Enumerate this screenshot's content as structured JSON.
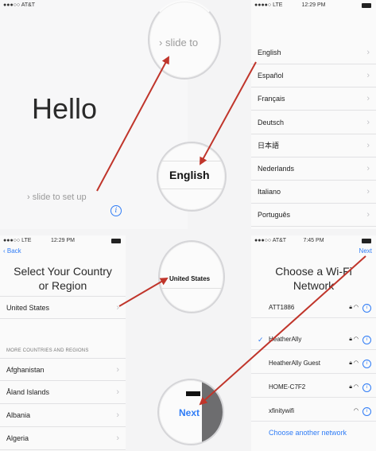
{
  "hello_screen": {
    "status": {
      "carrier": "AT&T",
      "signal": "●●●○○"
    },
    "title": "Hello",
    "slide_hint": "› slide to set up"
  },
  "magnifier_slide": {
    "text": "› slide to"
  },
  "magnifier_english": {
    "text": "English"
  },
  "magnifier_country": {
    "text": "United States"
  },
  "magnifier_next": {
    "text": "Next"
  },
  "language_screen": {
    "status": {
      "signal": "●●●●○",
      "network": "LTE",
      "time": "12:29 PM"
    },
    "languages": [
      {
        "label": "English"
      },
      {
        "label": "Español"
      },
      {
        "label": "Français"
      },
      {
        "label": "Deutsch"
      },
      {
        "label": "日本語"
      },
      {
        "label": "Nederlands"
      },
      {
        "label": "Italiano"
      },
      {
        "label": "Português"
      }
    ]
  },
  "country_screen": {
    "status": {
      "signal": "●●●○○",
      "network": "LTE",
      "time": "12:29 PM"
    },
    "back_label": "‹ Back",
    "heading_line1": "Select Your Country",
    "heading_line2": "or Region",
    "selected_country": "United States",
    "section_header": "MORE COUNTRIES AND REGIONS",
    "countries": [
      {
        "label": "Afghanistan"
      },
      {
        "label": "Åland Islands"
      },
      {
        "label": "Albania"
      },
      {
        "label": "Algeria"
      }
    ]
  },
  "wifi_screen": {
    "status": {
      "signal": "●●●○○",
      "carrier": "AT&T",
      "time": "7:45 PM"
    },
    "next_label": "Next",
    "heading_line1": "Choose a Wi-Fi",
    "heading_line2": "Network",
    "networks": [
      {
        "name": "ATT1886",
        "secured": true
      },
      {
        "name": "HeatherAlly",
        "secured": true,
        "connected": true
      },
      {
        "name": "HeatherAlly Guest",
        "secured": true
      },
      {
        "name": "HOME-C7F2",
        "secured": true
      },
      {
        "name": "xfinitywifi",
        "secured": false
      }
    ],
    "other_network_label": "Choose another network"
  },
  "colors": {
    "accent": "#2f7cf6",
    "arrow": "#c0352b",
    "text": "#222222",
    "divider": "#e1e1e3"
  }
}
